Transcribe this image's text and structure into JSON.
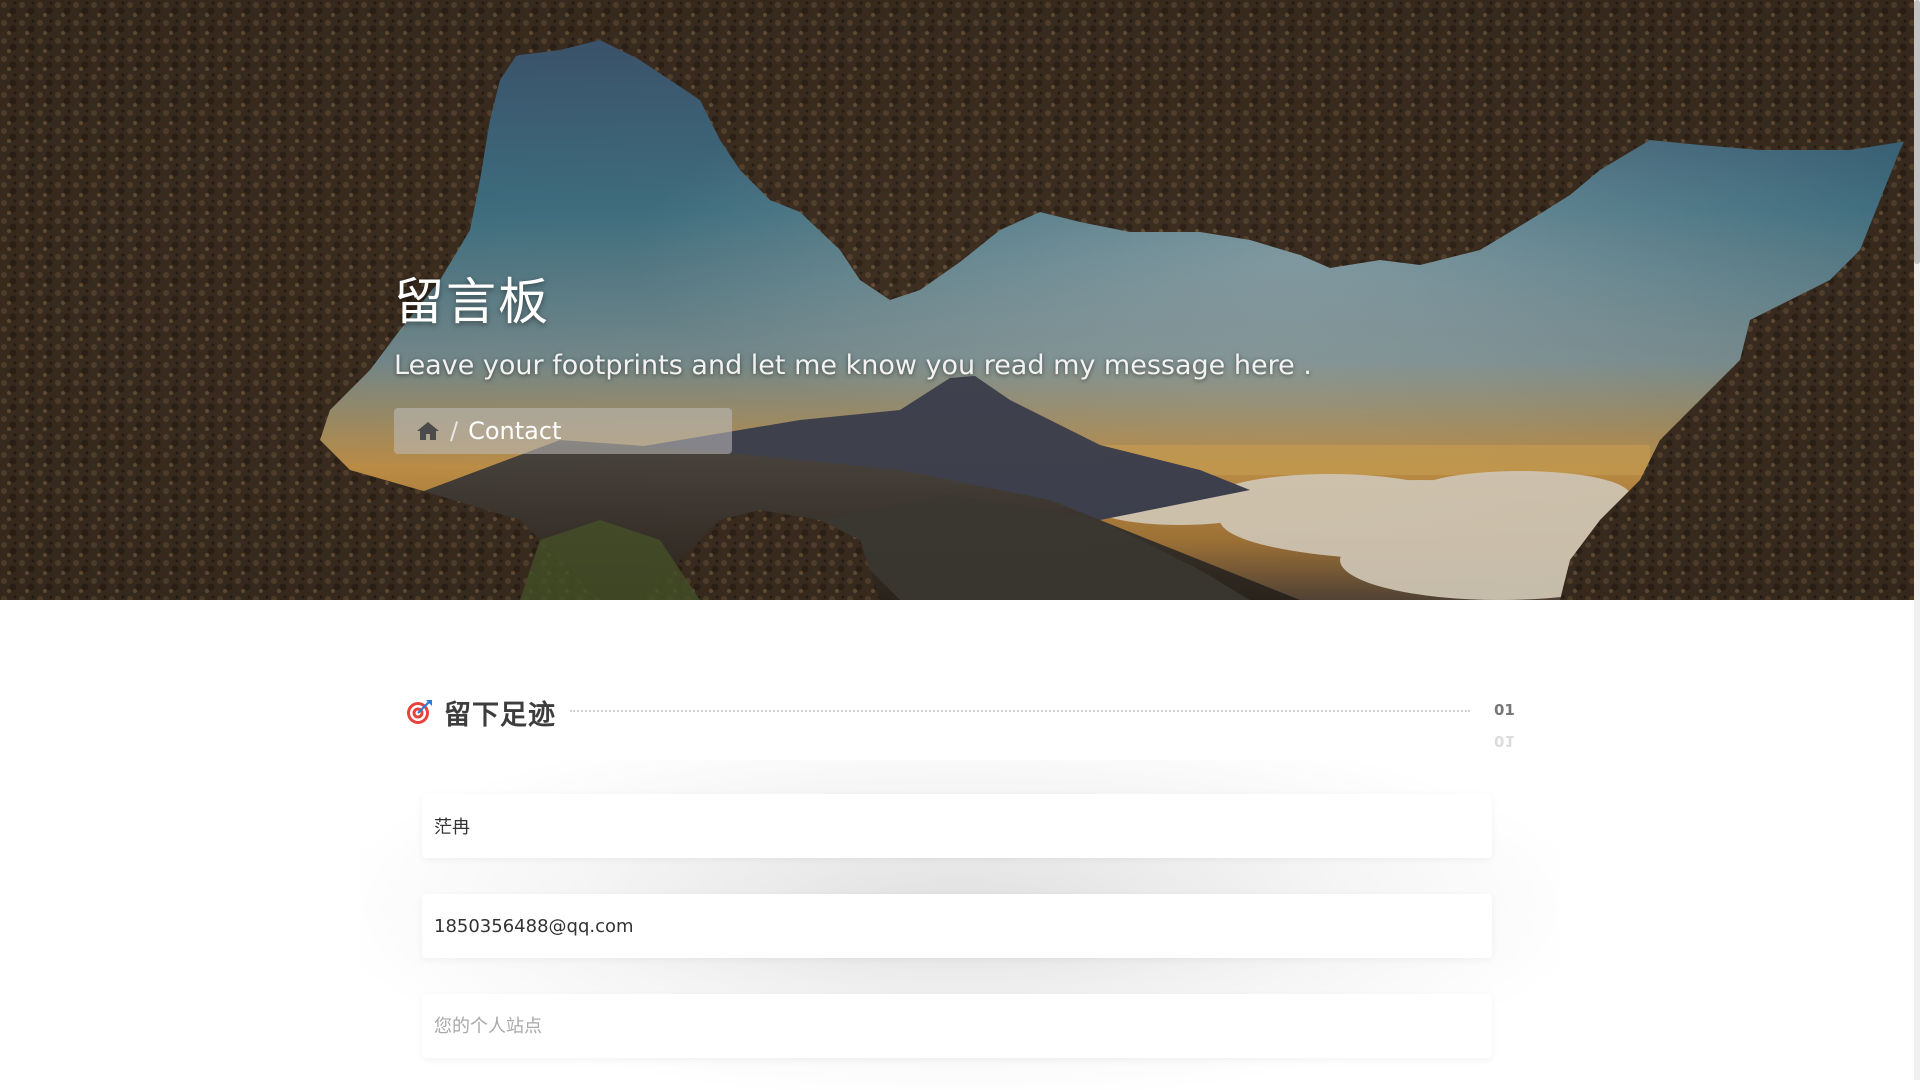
{
  "hero": {
    "title": "留言板",
    "subtitle": "Leave your footprints and let me know you read my message here .",
    "breadcrumb": {
      "home_icon": "home-icon",
      "separator": "/",
      "current": "Contact"
    }
  },
  "section": {
    "icon": "target-icon",
    "title": "留下足迹",
    "number": "01"
  },
  "form": {
    "name": {
      "value": "茫冉",
      "placeholder": ""
    },
    "email": {
      "value": "1850356488@qq.com",
      "placeholder": ""
    },
    "site": {
      "value": "",
      "placeholder": "您的个人站点"
    }
  },
  "colors": {
    "accent_red": "#e8433a",
    "accent_blue": "#2e7bd6",
    "title_text": "#3d3d3d"
  }
}
